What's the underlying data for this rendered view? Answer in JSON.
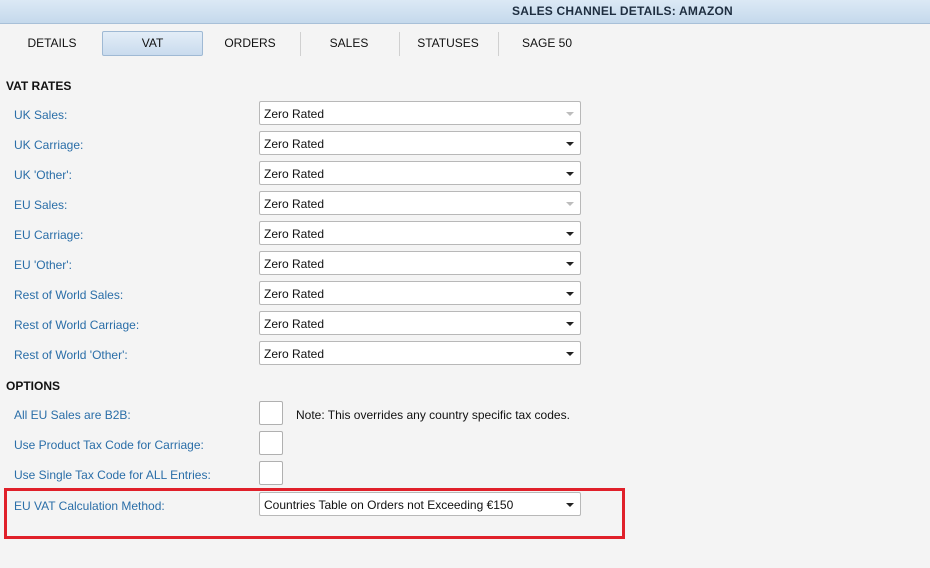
{
  "window": {
    "title": "SALES CHANNEL DETAILS: AMAZON"
  },
  "tabs": [
    {
      "label": "DETAILS",
      "active": false
    },
    {
      "label": "VAT",
      "active": true
    },
    {
      "label": "ORDERS",
      "active": false
    },
    {
      "label": "SALES",
      "active": false
    },
    {
      "label": "STATUSES",
      "active": false
    },
    {
      "label": "SAGE 50",
      "active": false
    }
  ],
  "vat_rates": {
    "header": "VAT RATES",
    "rows": [
      {
        "label": "UK Sales:",
        "value": "Zero Rated",
        "enabled": false
      },
      {
        "label": "UK Carriage:",
        "value": "Zero Rated",
        "enabled": true
      },
      {
        "label": "UK 'Other':",
        "value": "Zero Rated",
        "enabled": true
      },
      {
        "label": "EU Sales:",
        "value": "Zero Rated",
        "enabled": false
      },
      {
        "label": "EU Carriage:",
        "value": "Zero Rated",
        "enabled": true
      },
      {
        "label": "EU 'Other':",
        "value": "Zero Rated",
        "enabled": true
      },
      {
        "label": "Rest of World Sales:",
        "value": "Zero Rated",
        "enabled": true
      },
      {
        "label": "Rest of World Carriage:",
        "value": "Zero Rated",
        "enabled": true
      },
      {
        "label": "Rest of World 'Other':",
        "value": "Zero Rated",
        "enabled": true
      }
    ]
  },
  "options": {
    "header": "OPTIONS",
    "all_eu_b2b": {
      "label": "All EU Sales are B2B:",
      "checked": false,
      "note": "Note: This overrides any country specific tax codes."
    },
    "product_tax_carriage": {
      "label": "Use Product Tax Code for Carriage:",
      "checked": false
    },
    "single_tax_code": {
      "label": "Use Single Tax Code for ALL Entries:",
      "checked": false
    },
    "eu_vat_method": {
      "label": "EU VAT Calculation Method:",
      "value": "Countries Table on Orders not Exceeding €150"
    }
  },
  "colors": {
    "label": "#2a6ea8",
    "highlight": "#e0202a",
    "tab_active": "#c9dbee"
  }
}
